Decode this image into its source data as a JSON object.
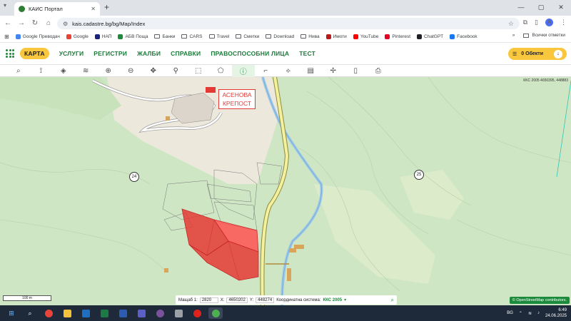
{
  "browser": {
    "tab_title": "КАИС Портал",
    "url": "kais.cadastre.bg/bg/Map/Index",
    "bookmarks": [
      "Google Преводач",
      "Google",
      "НАП",
      "АБВ Поща",
      "Банки",
      "CARS",
      "Travel",
      "Сметки",
      "Download",
      "Нива",
      "Имоти",
      "YouTube",
      "Pinterest",
      "ChatGPT",
      "Facebook"
    ],
    "bookmark_colors": [
      "#4285f4",
      "#ea4335",
      "#1a237e",
      "#1b8a3a",
      "",
      "",
      "",
      "",
      "",
      "",
      "#b71c1c",
      "#ff0000",
      "#e60023",
      "#202124",
      "#1877f2"
    ],
    "all_bookmarks": "Всички отметки",
    "profile_initial": "A"
  },
  "app_menu": {
    "items": [
      "КАРТА",
      "УСЛУГИ",
      "РЕГИСТРИ",
      "ЖАЛБИ",
      "СПРАВКИ",
      "ПРАВОСПОСОБНИ ЛИЦА",
      "ТЕСТ"
    ],
    "active_index": 0,
    "objects_label": "0 Обекти",
    "accent": "#1b7a3a",
    "highlight": "#f9c73d"
  },
  "toolbar": {
    "tools": [
      "search-icon",
      "measure-icon",
      "layers-icon",
      "layer-stack-icon",
      "zoom-in-icon",
      "zoom-out-icon",
      "pan-icon",
      "pin-icon",
      "select-rect-icon",
      "select-polygon-icon",
      "info-icon",
      "draw-line-icon",
      "draw-polygon-icon",
      "map-icon",
      "split-icon",
      "document-icon",
      "print-icon"
    ],
    "active_index": 10
  },
  "map": {
    "place_label_line1": "АСЕНОВА",
    "place_label_line2": "КРЕПОСТ",
    "road_24": "24",
    "road_25": "25",
    "kks_top": "КKC 2005  4650395, 448883"
  },
  "status": {
    "scale_label": "Мащаб 1:",
    "scale_value": "2820",
    "x_label": "X:",
    "x_value": "4650202",
    "y_label": "Y:",
    "y_value": "448274",
    "coord_system_label": "Координатна система:",
    "coord_system_value": "ККС 2005",
    "scalebar": "100 m",
    "osm_credit": "© OpenStreetMap contributors."
  },
  "taskbar": {
    "time": "6:49",
    "date": "24.06.2025",
    "lang": "BG"
  }
}
